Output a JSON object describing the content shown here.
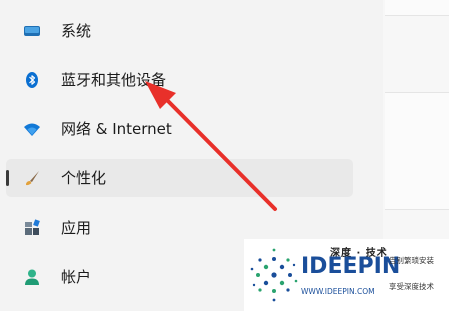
{
  "sidebar": {
    "items": [
      {
        "label": "系统",
        "icon": "monitor-icon",
        "selected": false
      },
      {
        "label": "蓝牙和其他设备",
        "icon": "bluetooth-icon",
        "selected": false
      },
      {
        "label": "网络 & Internet",
        "icon": "wifi-icon",
        "selected": false
      },
      {
        "label": "个性化",
        "icon": "paintbrush-icon",
        "selected": true
      },
      {
        "label": "应用",
        "icon": "apps-icon",
        "selected": false
      },
      {
        "label": "帐户",
        "icon": "person-icon",
        "selected": false
      }
    ]
  },
  "watermark": {
    "top": "深度 · 技术",
    "brand": "IDEEPIN",
    "url": "WWW.IDEEPIN.COM",
    "line1": "告别繁琐安装",
    "line2": "享受深度技术"
  },
  "colors": {
    "accent": "#0067c0",
    "arrow": "#e8302a",
    "selected_bg": "#e9e9e9",
    "watermark_blue": "#1a4e9a"
  }
}
